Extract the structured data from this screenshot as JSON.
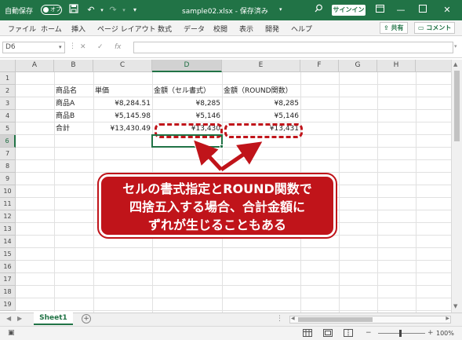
{
  "titlebar": {
    "autosave_label": "自動保存",
    "autosave_state": "オフ",
    "document_title": "sample02.xlsx - 保存済み",
    "signin_label": "サインイン",
    "icons": [
      "save-icon",
      "undo-icon",
      "redo-icon",
      "search-icon",
      "minimize-icon",
      "maximize-icon",
      "close-icon"
    ]
  },
  "ribbon": {
    "tabs": [
      "ファイル",
      "ホーム",
      "挿入",
      "ページ レイアウト",
      "数式",
      "データ",
      "校閲",
      "表示",
      "開発",
      "ヘルプ"
    ],
    "share_label": "共有",
    "comments_label": "コメント"
  },
  "formula_bar": {
    "name_box": "D6",
    "formula": ""
  },
  "grid": {
    "columns": [
      "A",
      "B",
      "C",
      "D",
      "E",
      "F",
      "G",
      "H"
    ],
    "rows": [
      "1",
      "2",
      "3",
      "4",
      "5",
      "6",
      "7",
      "8",
      "9",
      "10",
      "11",
      "12",
      "13",
      "14",
      "15",
      "16",
      "17",
      "18",
      "19"
    ],
    "selected_column": "D",
    "selected_row": "6",
    "cells": {
      "B2": "商品名",
      "C2": "単価",
      "D2": "金額（セル書式）",
      "E2": "金額（ROUND関数）",
      "B3": "商品A",
      "C3": "¥8,284.51",
      "D3": "¥8,285",
      "E3": "¥8,285",
      "B4": "商品B",
      "C4": "¥5,145.98",
      "D4": "¥5,146",
      "E4": "¥5,146",
      "B5": "合計",
      "C5": "¥13,430.49",
      "D5": "¥13,430",
      "E5": "¥13,431"
    }
  },
  "callout": {
    "lines": [
      "セルの書式指定とROUND関数で",
      "四捨五入する場合、合計金額に",
      "ずれが生じることもある"
    ],
    "color": "#c0141a"
  },
  "sheets": {
    "tabs": [
      "Sheet1"
    ]
  },
  "statusbar": {
    "zoom": "100%"
  },
  "colors": {
    "excel_green": "#217346",
    "highlight_red": "#c0141a"
  }
}
